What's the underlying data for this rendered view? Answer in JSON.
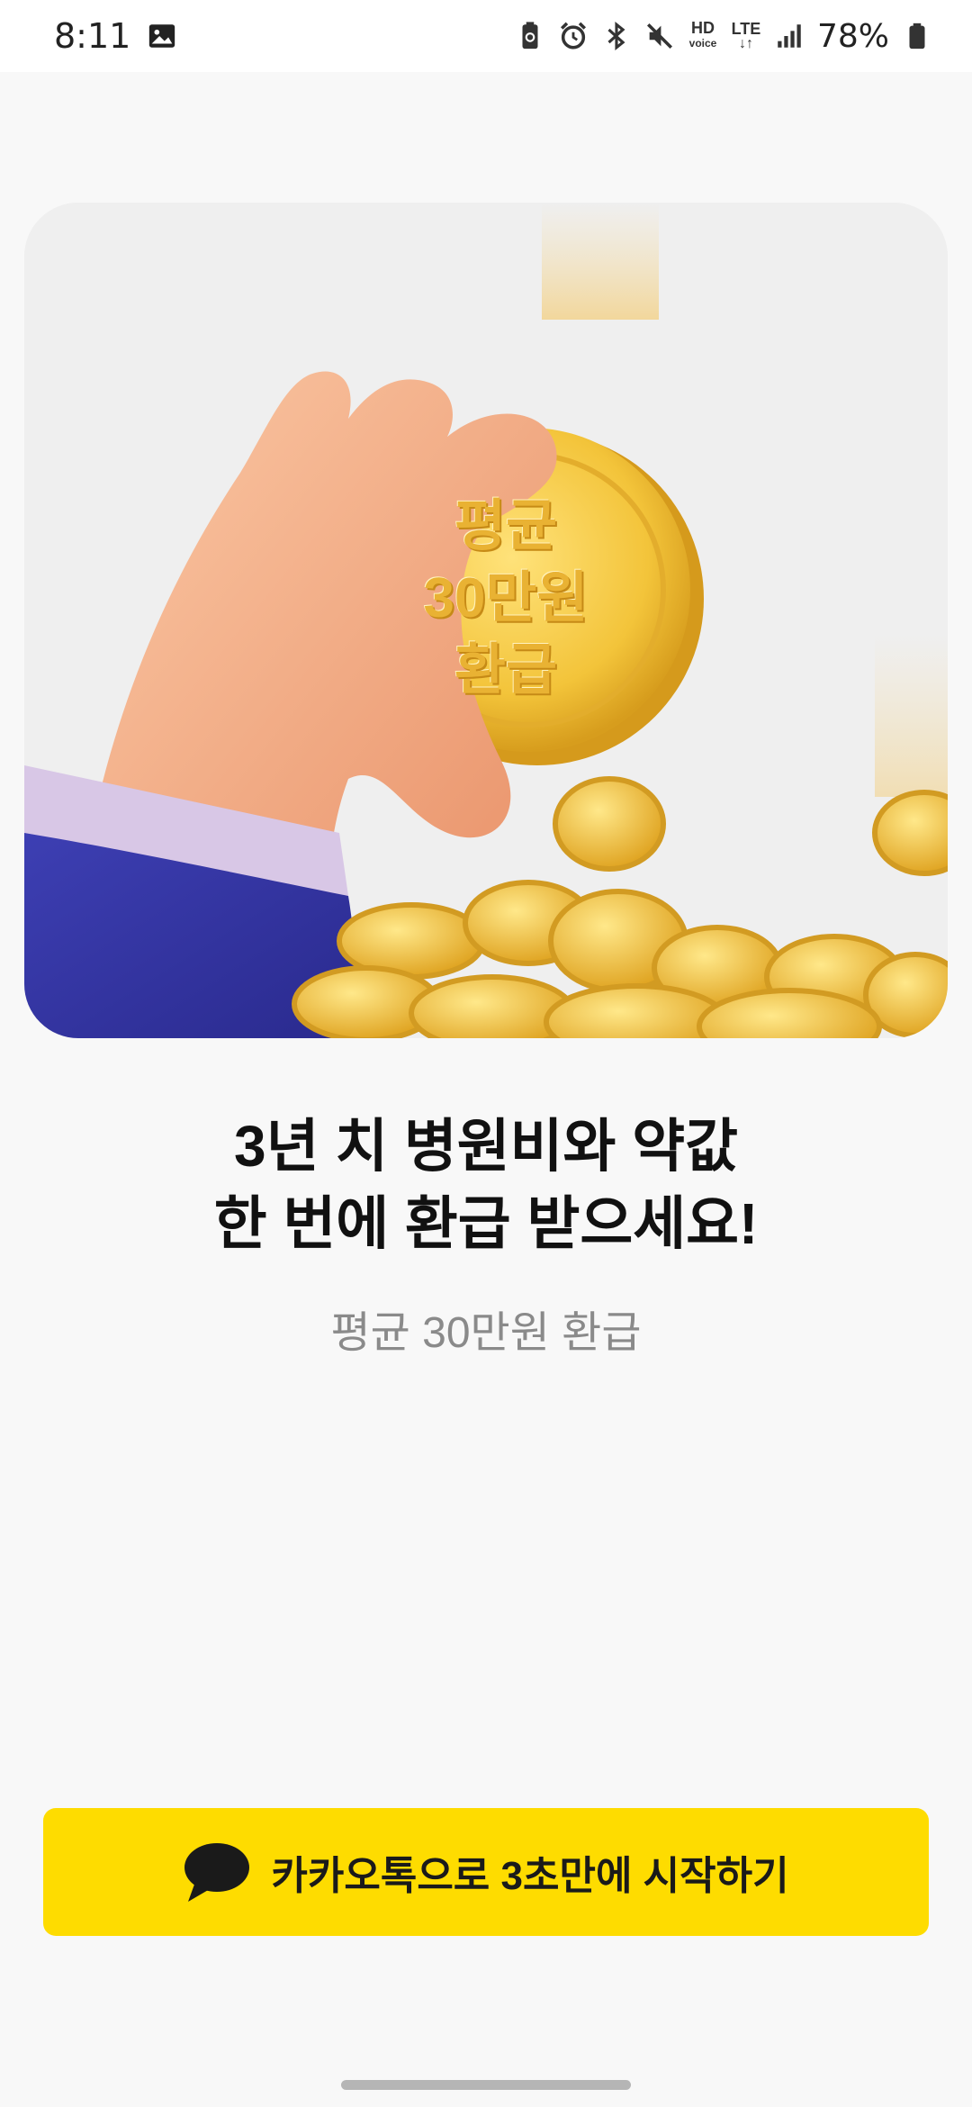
{
  "status_bar": {
    "time": "8:11",
    "battery_percent": "78%",
    "hd_label": "HD",
    "voice_label": "voice",
    "lte_label": "LTE",
    "icons": [
      "gallery-icon",
      "battery-saver-icon",
      "alarm-icon",
      "bluetooth-icon",
      "mute-icon",
      "hd-voice-icon",
      "lte-icon",
      "signal-icon",
      "battery-icon"
    ]
  },
  "hero": {
    "coin_lines": [
      "평균",
      "30만원",
      "환급"
    ]
  },
  "headline": {
    "line1": "3년 치 병원비와 약값",
    "line2": "한 번에 환급 받으세요!"
  },
  "subline": "평균 30만원 환급",
  "kakao_button": {
    "label": "카카오톡으로 3초만에 시작하기",
    "icon": "speech-bubble-icon"
  },
  "colors": {
    "kakao_yellow": "#FEDC00",
    "background": "#f8f8f8",
    "subtext": "#8a8a8a"
  }
}
